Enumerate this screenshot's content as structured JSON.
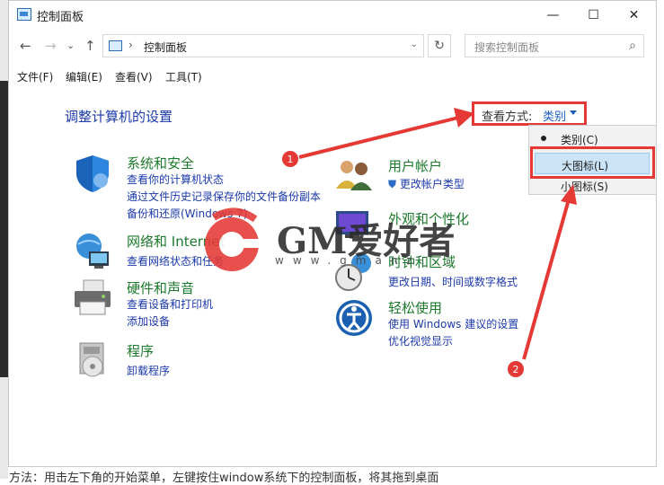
{
  "window": {
    "title": "控制面板",
    "minimize_glyph": "—",
    "maximize_glyph": "☐",
    "close_glyph": "✕"
  },
  "nav": {
    "back": "←",
    "forward": "→",
    "dropdown": "⌄",
    "up": "↑"
  },
  "address": {
    "separator": "›",
    "crumb": "控制面板",
    "dropdown": "⌄",
    "refresh": "↻"
  },
  "search": {
    "placeholder": "搜索控制面板",
    "icon": "⌕"
  },
  "menu": [
    "文件(F)",
    "编辑(E)",
    "查看(V)",
    "工具(T)"
  ],
  "heading": "调整计算机的设置",
  "view_by": {
    "label": "查看方式:",
    "value": "类别"
  },
  "dropdown": {
    "items": [
      "类别(C)",
      "大图标(L)",
      "小图标(S)"
    ],
    "selected_index": 0,
    "highlighted_index": 1
  },
  "categories": [
    {
      "title": "系统和安全",
      "icon": "shield-icon",
      "links": [
        "查看你的计算机状态",
        "通过文件历史记录保存你的文件备份副本",
        "备份和还原(Windows 7)"
      ]
    },
    {
      "title": "网络和 Internet",
      "icon": "network-globe-icon",
      "links": [
        "查看网络状态和任务"
      ]
    },
    {
      "title": "硬件和声音",
      "icon": "printer-icon",
      "links": [
        "查看设备和打印机",
        "添加设备"
      ]
    },
    {
      "title": "程序",
      "icon": "program-disc-icon",
      "links": [
        "卸载程序"
      ]
    },
    {
      "title": "用户帐户",
      "icon": "users-icon",
      "links": [
        "更改帐户类型"
      ]
    },
    {
      "title": "外观和个性化",
      "icon": "appearance-icon",
      "links": []
    },
    {
      "title": "时钟和区域",
      "icon": "clock-globe-icon",
      "links": [
        "更改日期、时间或数字格式"
      ]
    },
    {
      "title": "轻松使用",
      "icon": "ease-of-access-icon",
      "links": [
        "使用 Windows 建议的设置",
        "优化视觉显示"
      ]
    }
  ],
  "annotations": {
    "marker_1": "1",
    "marker_2": "2",
    "color": "#e53935"
  },
  "watermark": {
    "text": "GM爱好者",
    "sub": "www.gmanz..."
  },
  "caption": "方法：用击左下角的开始菜单，左键按住window系统下的控制面板，将其拖到桌面"
}
